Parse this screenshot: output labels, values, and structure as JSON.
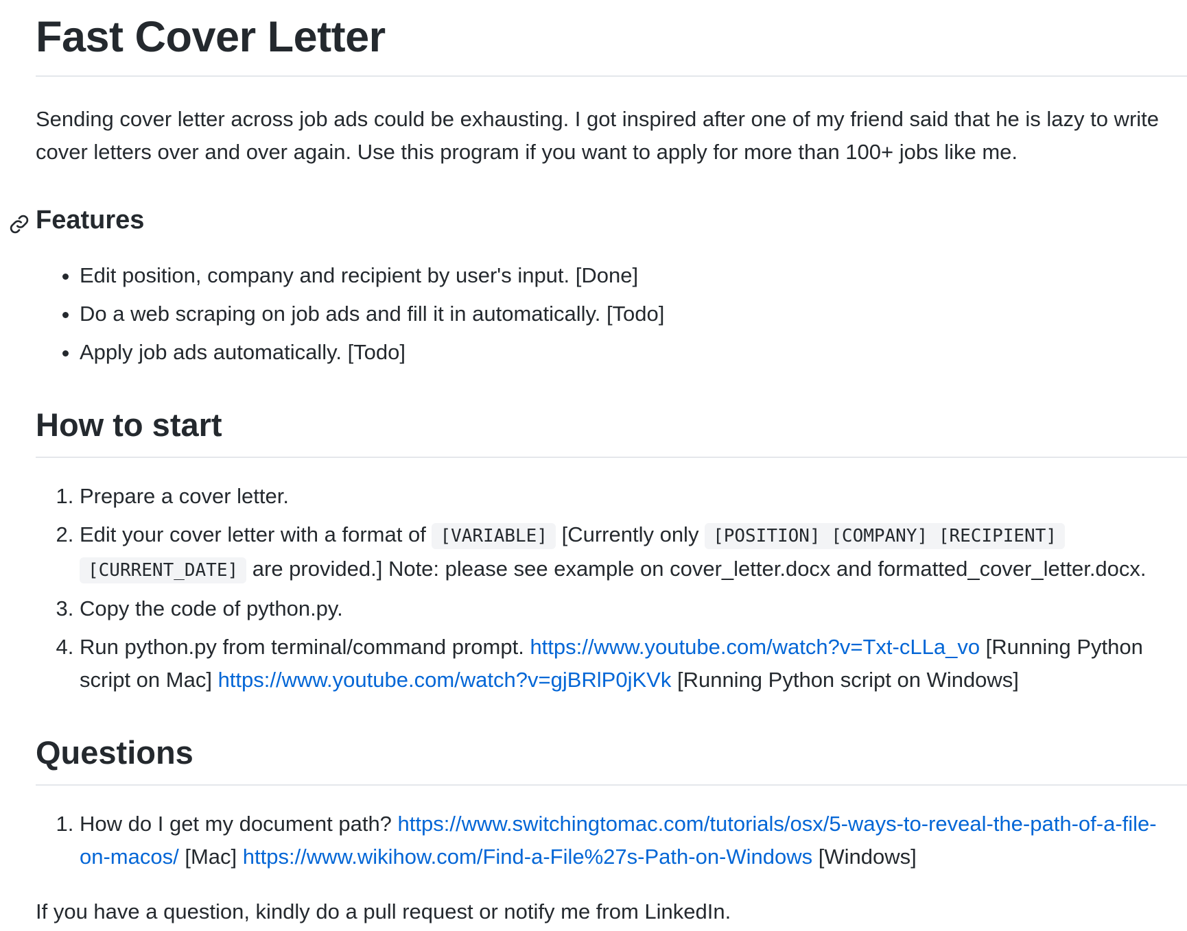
{
  "title": "Fast Cover Letter",
  "intro": "Sending cover letter across job ads could be exhausting. I got inspired after one of my friend said that he is lazy to write cover letters over and over again. Use this program if you want to apply for more than 100+ jobs like me.",
  "features": {
    "heading": "Features",
    "items": [
      "Edit position, company and recipient by user's input. [Done]",
      "Do a web scraping on job ads and fill it in automatically. [Todo]",
      "Apply job ads automatically. [Todo]"
    ]
  },
  "how_to_start": {
    "heading": "How to start",
    "step1": "Prepare a cover letter.",
    "step2": {
      "text_a": "Edit your cover letter with a format of ",
      "code_variable": "[VARIABLE]",
      "text_b": " [Currently only ",
      "code_position": "[POSITION]",
      "code_company": "[COMPANY]",
      "code_recipient": "[RECIPIENT]",
      "code_current_date": "[CURRENT_DATE]",
      "text_c": " are provided.] Note: please see example on cover_letter.docx and formatted_cover_letter.docx."
    },
    "step3": "Copy the code of python.py.",
    "step4": {
      "text_a": "Run python.py from terminal/command prompt. ",
      "link_mac": "https://www.youtube.com/watch?v=Txt-cLLa_vo",
      "text_b": " [Running Python script on Mac] ",
      "link_windows": "https://www.youtube.com/watch?v=gjBRlP0jKVk",
      "text_c": " [Running Python script on Windows]"
    }
  },
  "questions": {
    "heading": "Questions",
    "q1": {
      "text_a": "How do I get my document path? ",
      "link_mac": "https://www.switchingtomac.com/tutorials/osx/5-ways-to-reveal-the-path-of-a-file-on-macos/",
      "text_b": " [Mac] ",
      "link_windows": "https://www.wikihow.com/Find-a-File%27s-Path-on-Windows",
      "text_c": " [Windows]"
    }
  },
  "outro": "If you have a question, kindly do a pull request or notify me from LinkedIn.",
  "colors": {
    "text": "#24292e",
    "link": "#0366d6",
    "rule": "#e4e7eb",
    "code_bg": "#f3f4f6"
  },
  "icons": {
    "features_anchor": "link-icon"
  }
}
